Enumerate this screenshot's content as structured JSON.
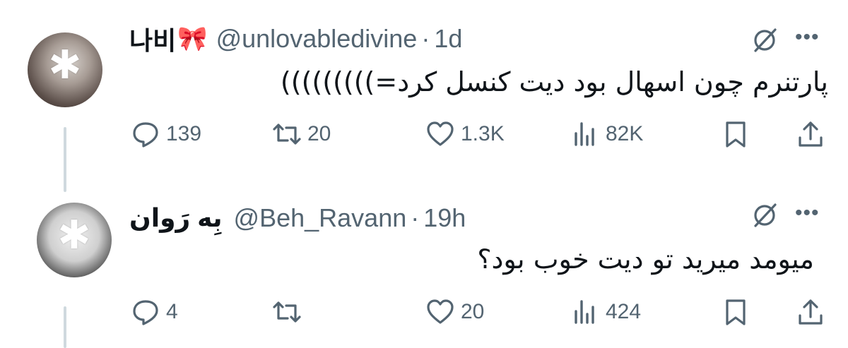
{
  "tweets": [
    {
      "display_name": "나비",
      "emoji": "🎀",
      "handle": "@unlovabledivine",
      "separator": "·",
      "time": "1d",
      "text": "پارتنرم چون اسهال بود دیت کنسل کرد=)))))))))",
      "actions": {
        "replies": "139",
        "reposts": "20",
        "likes": "1.3K",
        "views": "82K"
      }
    },
    {
      "display_name": "بِه رَوان",
      "handle": "@Beh_Ravann",
      "separator": "·",
      "time": "19h",
      "text": "میومد میرید تو دیت خوب بود؟",
      "actions": {
        "replies": "4",
        "reposts": "",
        "likes": "20",
        "views": "424"
      }
    }
  ],
  "icons": {
    "avatar_overlay": "star-icon",
    "grok": "grok-icon",
    "more": "more-icon",
    "reply": "reply-icon",
    "repost": "repost-icon",
    "like": "heart-icon",
    "views": "views-icon",
    "bookmark": "bookmark-icon",
    "share": "share-icon"
  },
  "colors": {
    "text": "#0f1419",
    "secondary": "#536471",
    "thread_line": "#cfd9de",
    "bow": "#f7a1c4"
  }
}
